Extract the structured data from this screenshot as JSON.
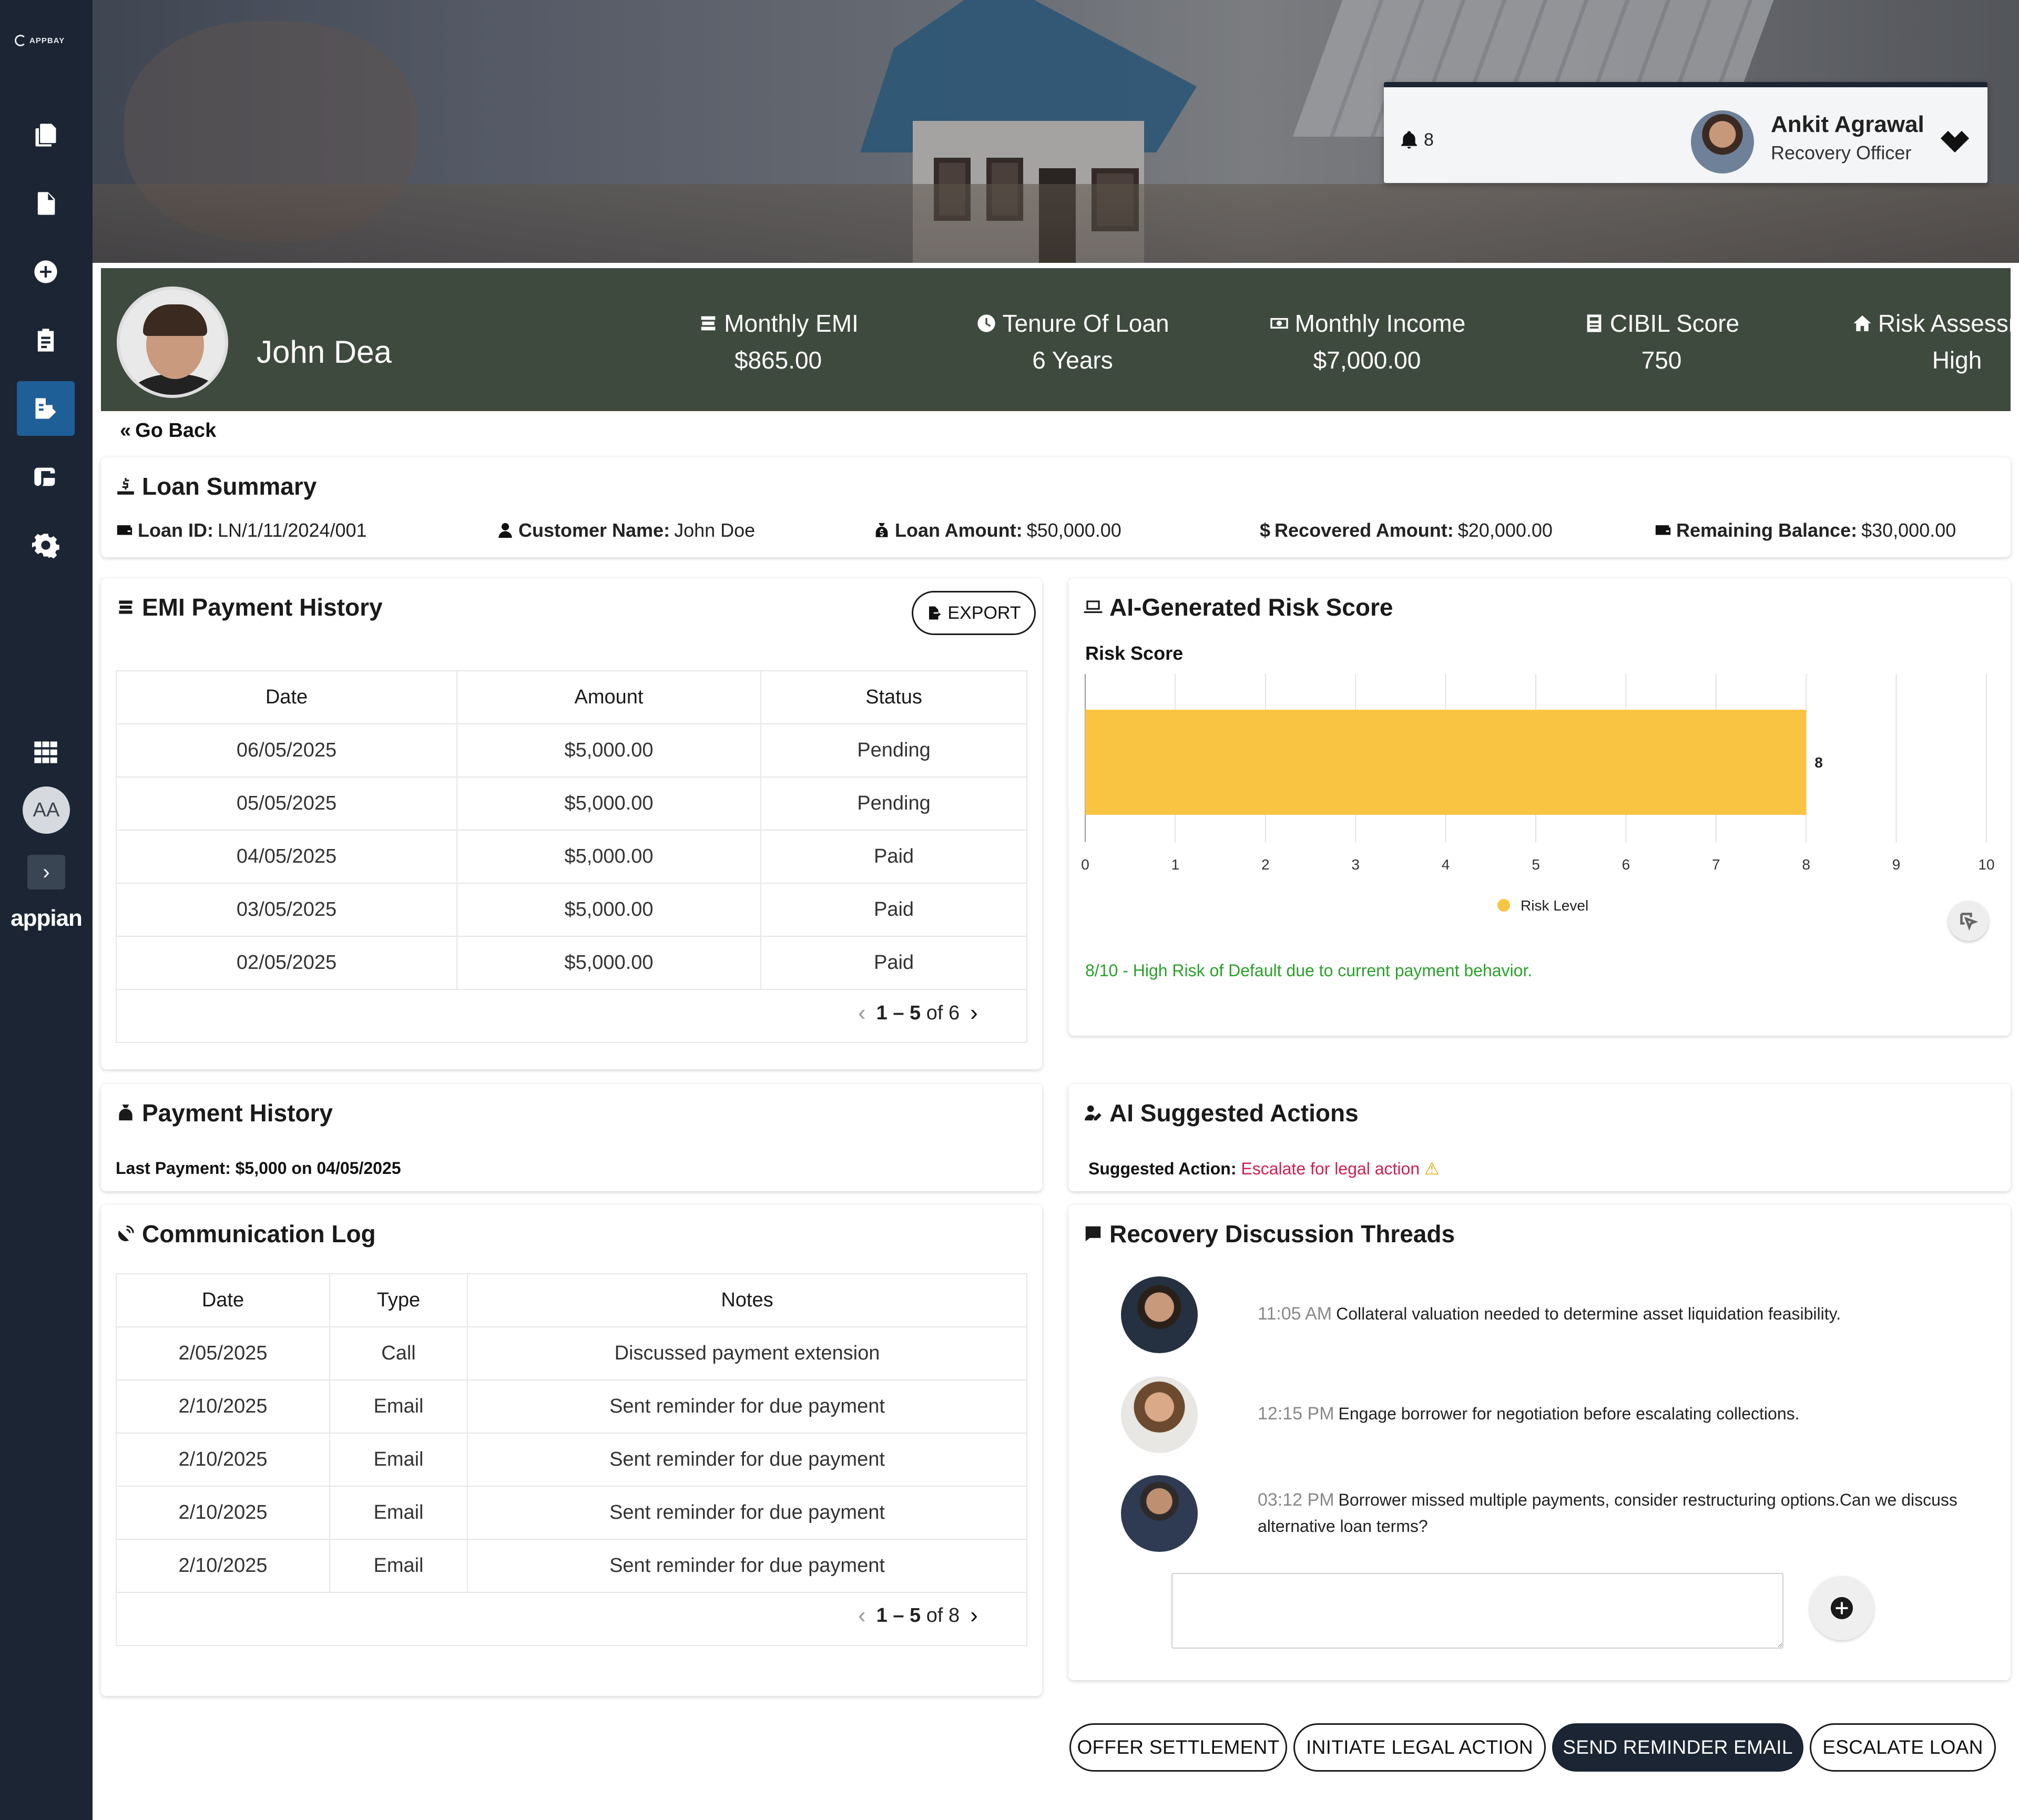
{
  "sidebar": {
    "logo_text": "APPBAY",
    "avatar_initials": "AA",
    "brand": "appian"
  },
  "header": {
    "notification_count": "8",
    "user_name": "Ankit Agrawal",
    "user_role": "Recovery Officer"
  },
  "borrower": {
    "name": "John Dea",
    "stats": [
      {
        "label": "Monthly EMI",
        "value": "$865.00",
        "icon": "coins-icon"
      },
      {
        "label": "Tenure Of Loan",
        "value": "6 Years",
        "icon": "clock-icon"
      },
      {
        "label": "Monthly Income",
        "value": "$7,000.00",
        "icon": "money-bill-icon"
      },
      {
        "label": "CIBIL Score",
        "value": "750",
        "icon": "book-icon"
      },
      {
        "label": "Risk Assessment",
        "value": "High",
        "icon": "home-icon"
      }
    ]
  },
  "nav": {
    "go_back": "Go Back"
  },
  "loan_summary": {
    "title": "Loan Summary",
    "items": [
      {
        "label": "Loan ID:",
        "value": "LN/1/11/2024/001"
      },
      {
        "label": "Customer Name:",
        "value": "John Doe"
      },
      {
        "label": "Loan Amount:",
        "value": "$50,000.00"
      },
      {
        "label": "Recovered Amount:",
        "value": "$20,000.00"
      },
      {
        "label": "Remaining Balance:",
        "value": "$30,000.00"
      }
    ]
  },
  "emi_history": {
    "title": "EMI Payment History",
    "export_label": "EXPORT",
    "columns": [
      "Date",
      "Amount",
      "Status"
    ],
    "rows": [
      [
        "06/05/2025",
        "$5,000.00",
        "Pending"
      ],
      [
        "05/05/2025",
        "$5,000.00",
        "Pending"
      ],
      [
        "04/05/2025",
        "$5,000.00",
        "Paid"
      ],
      [
        "03/05/2025",
        "$5,000.00",
        "Paid"
      ],
      [
        "02/05/2025",
        "$5,000.00",
        "Paid"
      ]
    ],
    "pager_range": "1 – 5",
    "pager_total": "of 6"
  },
  "risk": {
    "title": "AI-Generated Risk Score",
    "note": "8/10 - High Risk of Default due to current payment behavior."
  },
  "chart_data": {
    "type": "bar",
    "orientation": "horizontal",
    "title": "Risk Score",
    "categories": [
      ""
    ],
    "series": [
      {
        "name": "Risk Level",
        "values": [
          8
        ],
        "color": "#fac443"
      }
    ],
    "data_labels": [
      "8"
    ],
    "xlim": [
      0,
      10
    ],
    "xticks": [
      "0",
      "1",
      "2",
      "3",
      "4",
      "5",
      "6",
      "7",
      "8",
      "9",
      "10"
    ],
    "grid": true,
    "legend_position": "bottom"
  },
  "payment_history": {
    "title": "Payment History",
    "last_payment": "Last Payment: $5,000 on 04/05/2025"
  },
  "suggested": {
    "title": "AI Suggested Actions",
    "label": "Suggested Action:",
    "action": "Escalate for legal action",
    "warn_icon": "⚠"
  },
  "comm_log": {
    "title": "Communication Log",
    "columns": [
      "Date",
      "Type",
      "Notes"
    ],
    "rows": [
      [
        "2/05/2025",
        "Call",
        "Discussed payment extension"
      ],
      [
        "2/10/2025",
        "Email",
        "Sent reminder for due payment"
      ],
      [
        "2/10/2025",
        "Email",
        "Sent reminder for due payment"
      ],
      [
        "2/10/2025",
        "Email",
        "Sent reminder for due payment"
      ],
      [
        "2/10/2025",
        "Email",
        "Sent reminder for due payment"
      ]
    ],
    "pager_range": "1 – 5",
    "pager_total": "of 8"
  },
  "threads": {
    "title": "Recovery Discussion Threads",
    "items": [
      {
        "time": "11:05 AM",
        "text": "Collateral valuation needed to determine asset liquidation feasibility."
      },
      {
        "time": "12:15 PM",
        "text": "Engage borrower for negotiation before escalating collections."
      },
      {
        "time": "03:12 PM",
        "text": "Borrower missed multiple payments, consider restructuring options.Can we discuss alternative loan terms?"
      }
    ],
    "reply_value": ""
  },
  "actions": {
    "offer": "OFFER SETTLEMENT",
    "legal": "INITIATE LEGAL ACTION",
    "reminder": "SEND REMINDER EMAIL",
    "escalate": "ESCALATE LOAN"
  },
  "colors": {
    "sidebar": "#1b2533",
    "banner": "#3f4a3e",
    "bar": "#fac443",
    "note_green": "#2aa02a",
    "action_red": "#d01f4e"
  }
}
